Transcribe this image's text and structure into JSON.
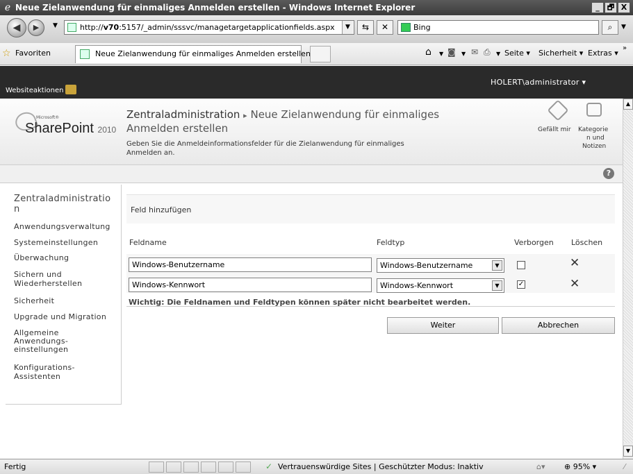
{
  "window": {
    "title": "Neue Zielanwendung für einmaliges Anmelden erstellen - Windows Internet Explorer",
    "buttons": [
      "_",
      "🗗",
      "X"
    ]
  },
  "address_bar": {
    "prefix": "http://",
    "host": "v70",
    "rest": ":5157/_admin/sssvc/managetargetapplicationfields.aspx",
    "search_placeholder": "Bing"
  },
  "favorites_bar": {
    "favorites_label": "Favoriten",
    "tab_label": "Neue Zielanwendung für einmaliges Anmelden erstellen",
    "seite": "Seite",
    "sicherheit": "Sicherheit",
    "extras": "Extras"
  },
  "ribbon": {
    "site_actions": "Websiteaktionen",
    "user": "HOLERT\\administrator"
  },
  "header": {
    "logo_small": "Microsoft®",
    "logo_main": "SharePoint",
    "logo_year": "2010",
    "breadcrumb_root": "Zentraladministration",
    "breadcrumb_sep": "▸",
    "title_line1": "Neue Zielanwendung für einmaliges",
    "title_line2": "Anmelden erstellen",
    "desc_line1": "Geben Sie die Anmeldeinformationsfelder für die Zielanwendung für einmaliges",
    "desc_line2": "Anmelden an.",
    "like_label": "Gefällt mir",
    "tags_line1": "Kategorie",
    "tags_line2": "n und",
    "tags_line3": "Notizen"
  },
  "leftnav": {
    "title_line1": "Zentraladministratio",
    "title_line2": "n",
    "items": [
      "Anwendungsverwaltung",
      "Systemeinstellungen",
      "Überwachung",
      "Sichern und",
      "Wiederherstellen",
      "Sicherheit",
      "Upgrade und Migration",
      "Allgemeine",
      "Anwendungs-",
      "einstellungen",
      "Konfigurations-",
      "Assistenten"
    ]
  },
  "content": {
    "add_field": "Feld hinzufügen",
    "col_name": "Feldname",
    "col_type": "Feldtyp",
    "col_hidden": "Verborgen",
    "col_delete": "Löschen",
    "rows": [
      {
        "name": "Windows-Benutzername",
        "type": "Windows-Benutzername",
        "hidden": false
      },
      {
        "name": "Windows-Kennwort",
        "type": "Windows-Kennwort",
        "hidden": true
      }
    ],
    "warning": "Wichtig: Die Feldnamen und Feldtypen können später nicht bearbeitet werden.",
    "next_button": "Weiter",
    "cancel_button": "Abbrechen"
  },
  "status_bar": {
    "text": "Fertig",
    "zone": "Vertrauenswürdige Sites | Geschützter Modus: Inaktiv",
    "zoom": "95%"
  }
}
